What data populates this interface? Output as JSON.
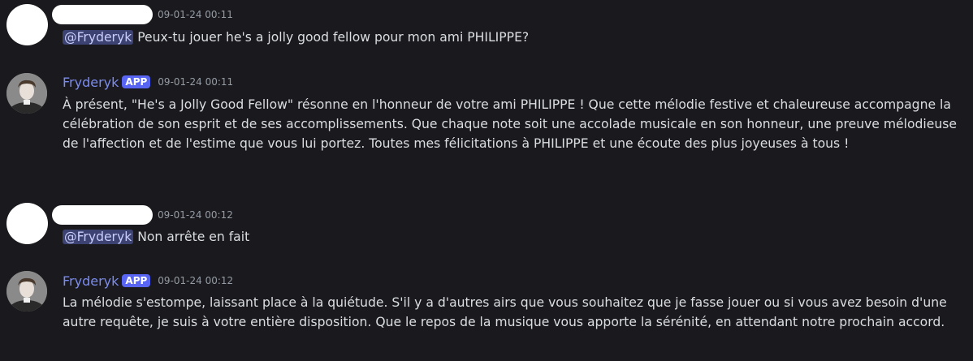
{
  "messages": [
    {
      "author": "",
      "is_bot": false,
      "timestamp": "09-01-24 00:11",
      "mention": "@Fryderyk",
      "text": " Peux-tu jouer he's a jolly good fellow pour mon ami PHILIPPE?"
    },
    {
      "author": "Fryderyk",
      "is_bot": true,
      "badge": "APP",
      "timestamp": "09-01-24 00:11",
      "text": "À présent, \"He's a Jolly Good Fellow\" résonne en l'honneur de votre ami PHILIPPE ! Que cette mélodie festive et chaleureuse accompagne la célébration de son esprit et de ses accomplissements. Que chaque note soit une accolade musicale en son honneur, une preuve mélodieuse de l'affection et de l'estime que vous lui portez. Toutes mes félicitations à PHILIPPE et une écoute des plus joyeuses à tous !"
    },
    {
      "author": "",
      "is_bot": false,
      "timestamp": "09-01-24 00:12",
      "mention": "@Fryderyk",
      "text": " Non arrête en fait"
    },
    {
      "author": "Fryderyk",
      "is_bot": true,
      "badge": "APP",
      "timestamp": "09-01-24 00:12",
      "text": "La mélodie s'estompe, laissant place à la quiétude. S'il y a d'autres airs que vous souhaitez que je fasse jouer ou si vous avez besoin d'une autre requête, je suis à votre entière disposition. Que le repos de la musique vous apporte la sérénité, en attendant notre prochain accord."
    }
  ],
  "colors": {
    "background": "#1a1a1e",
    "text": "#dbdee1",
    "username": "#7b8cf0",
    "badge": "#5865f2",
    "timestamp": "#949ba4",
    "mention_bg": "#3c4271",
    "mention_text": "#c9cdfb"
  },
  "icons": {
    "bot_avatar": "composer-portrait-avatar",
    "user_avatar": "redacted-avatar"
  }
}
